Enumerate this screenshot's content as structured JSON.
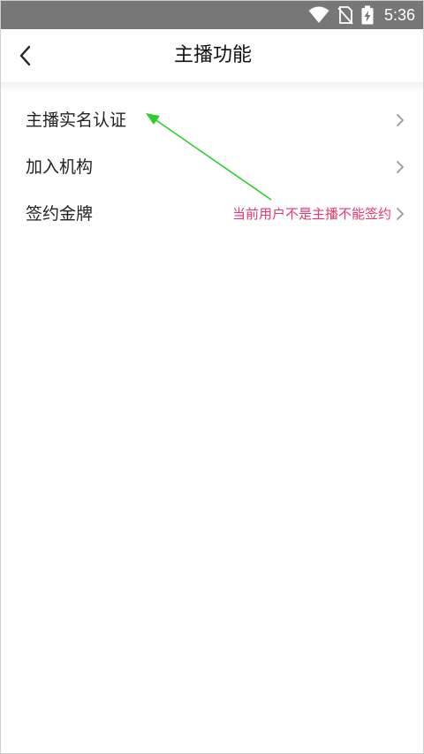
{
  "status_bar": {
    "time": "5:36",
    "icons": [
      "wifi-icon",
      "no-sim-icon",
      "battery-charging-icon"
    ]
  },
  "nav": {
    "title": "主播功能",
    "back_icon": "chevron-left-icon"
  },
  "menu": {
    "items": [
      {
        "label": "主播实名认证",
        "hint": ""
      },
      {
        "label": "加入机构",
        "hint": ""
      },
      {
        "label": "签约金牌",
        "hint": "当前用户不是主播不能签约"
      }
    ]
  },
  "colors": {
    "status_bar_bg": "#777777",
    "hint_text": "#e8396a",
    "annotation_arrow": "#2ecc2e"
  }
}
